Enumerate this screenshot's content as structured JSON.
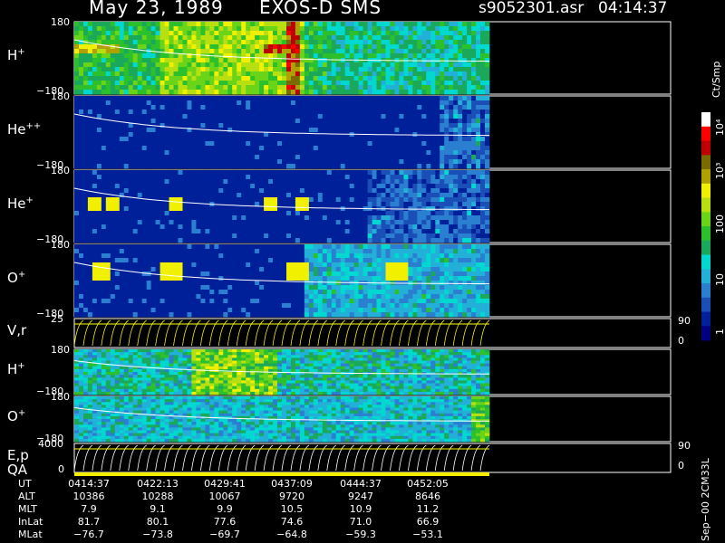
{
  "header": {
    "date": "May 23, 1989",
    "mission": "EXOS-D SMS",
    "file": "s9052301.asr",
    "time": "04:14:37"
  },
  "colorbar": {
    "unit": "Ct/Smp",
    "tick_labels": [
      "10⁴",
      "10³",
      "100",
      "10",
      "1"
    ],
    "colors": [
      "#000080",
      "#00209a",
      "#1a4fb8",
      "#2a7fd0",
      "#22b0d8",
      "#00d8d0",
      "#1aa85a",
      "#2cc02c",
      "#6ad418",
      "#b8e010",
      "#f0f000",
      "#b0a000",
      "#7a6a00",
      "#c00000",
      "#ff0000",
      "#ffffff"
    ]
  },
  "panels": [
    {
      "id": "h-plus",
      "ion": "H",
      "charge": "+",
      "ymax": "180",
      "ymin": "−180"
    },
    {
      "id": "he-plus-plus",
      "ion": "He",
      "charge": "++",
      "ymax": "180",
      "ymin": "−180"
    },
    {
      "id": "he-plus",
      "ion": "He",
      "charge": "+",
      "ymax": "180",
      "ymin": "−180"
    },
    {
      "id": "o-plus",
      "ion": "O",
      "charge": "+",
      "ymax": "180",
      "ymin": "−180"
    },
    {
      "id": "v-r",
      "ion": "V,r",
      "charge": "",
      "ymax": "25",
      "ymin": "",
      "right_top": "90",
      "right_bottom": "0"
    },
    {
      "id": "h-plus-2",
      "ion": "H",
      "charge": "+",
      "ymax": "180",
      "ymin": "−180"
    },
    {
      "id": "o-plus-2",
      "ion": "O",
      "charge": "+",
      "ymax": "180",
      "ymin": "−180"
    },
    {
      "id": "e-p",
      "ion": "E,p",
      "charge": "",
      "ymax": "4000",
      "ymin": "0",
      "right_top": "90",
      "right_bottom": "0"
    }
  ],
  "qa_label": "QA",
  "side_note": "Sep−00  2CM33L",
  "ephemeris": {
    "labels": [
      "UT",
      "ALT",
      "MLT",
      "InLat",
      "MLat"
    ],
    "columns": [
      {
        "UT": "0414:37",
        "ALT": "10386",
        "MLT": "7.9",
        "InLat": "81.7",
        "MLat": "−76.7"
      },
      {
        "UT": "0422:13",
        "ALT": "10288",
        "MLT": "9.1",
        "InLat": "80.1",
        "MLat": "−73.8"
      },
      {
        "UT": "0429:41",
        "ALT": "10067",
        "MLT": "9.9",
        "InLat": "77.6",
        "MLat": "−69.7"
      },
      {
        "UT": "0437:09",
        "ALT": "9720",
        "MLT": "10.5",
        "InLat": "74.6",
        "MLat": "−64.8"
      },
      {
        "UT": "0444:37",
        "ALT": "9247",
        "MLT": "10.9",
        "InLat": "71.0",
        "MLat": "−59.3"
      },
      {
        "UT": "0452:05",
        "ALT": "8646",
        "MLT": "11.2",
        "InLat": "66.9",
        "MLat": "−53.1"
      }
    ]
  },
  "chart_data": {
    "type": "heatmap",
    "title": "May 23, 1989   EXOS-D SMS",
    "x_tick_labels": [
      "0414:37",
      "0422:13",
      "0429:41",
      "0437:09",
      "0444:37",
      "0452:05"
    ],
    "colorbar_label": "Ct/Smp",
    "colorbar_scale": "log",
    "colorbar_range": [
      1,
      10000
    ],
    "series": [
      {
        "name": "H+",
        "ylim": [
          -180,
          180
        ]
      },
      {
        "name": "He++",
        "ylim": [
          -180,
          180
        ]
      },
      {
        "name": "He+",
        "ylim": [
          -180,
          180
        ]
      },
      {
        "name": "O+",
        "ylim": [
          -180,
          180
        ]
      },
      {
        "name": "V,r",
        "ylim": [
          0,
          25
        ]
      },
      {
        "name": "H+",
        "ylim": [
          -180,
          180
        ]
      },
      {
        "name": "O+",
        "ylim": [
          -180,
          180
        ]
      },
      {
        "name": "E,p",
        "ylim": [
          0,
          4000
        ]
      }
    ]
  }
}
